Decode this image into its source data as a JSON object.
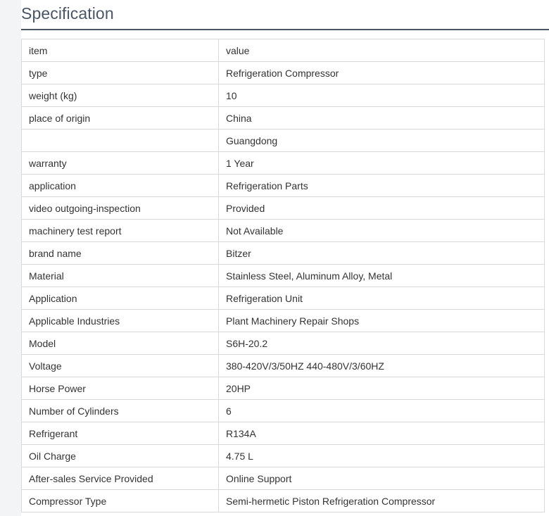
{
  "heading": {
    "title": "Specification"
  },
  "table": {
    "rows": [
      {
        "item": "item",
        "value": "value"
      },
      {
        "item": "type",
        "value": "Refrigeration Compressor"
      },
      {
        "item": "weight (kg)",
        "value": "10"
      },
      {
        "item": "place of origin",
        "value": "China"
      },
      {
        "item": "",
        "value": "Guangdong"
      },
      {
        "item": "warranty",
        "value": "1 Year"
      },
      {
        "item": "application",
        "value": "Refrigeration Parts"
      },
      {
        "item": "video outgoing-inspection",
        "value": "Provided"
      },
      {
        "item": "machinery test report",
        "value": "Not Available"
      },
      {
        "item": "brand name",
        "value": "Bitzer"
      },
      {
        "item": "Material",
        "value": "Stainless Steel, Aluminum Alloy, Metal"
      },
      {
        "item": "Application",
        "value": "Refrigeration Unit"
      },
      {
        "item": "Applicable Industries",
        "value": "Plant Machinery Repair Shops"
      },
      {
        "item": "Model",
        "value": "S6H-20.2"
      },
      {
        "item": "Voltage",
        "value": "380-420V/3/50HZ 440-480V/3/60HZ"
      },
      {
        "item": "Horse Power",
        "value": "20HP"
      },
      {
        "item": "Number of Cylinders",
        "value": "6"
      },
      {
        "item": "Refrigerant",
        "value": "R134A"
      },
      {
        "item": "Oil Charge",
        "value": "4.75 L"
      },
      {
        "item": "After-sales Service Provided",
        "value": "Online Support"
      },
      {
        "item": "Compressor Type",
        "value": "Semi-hermetic Piston Refrigeration Compressor"
      }
    ]
  }
}
